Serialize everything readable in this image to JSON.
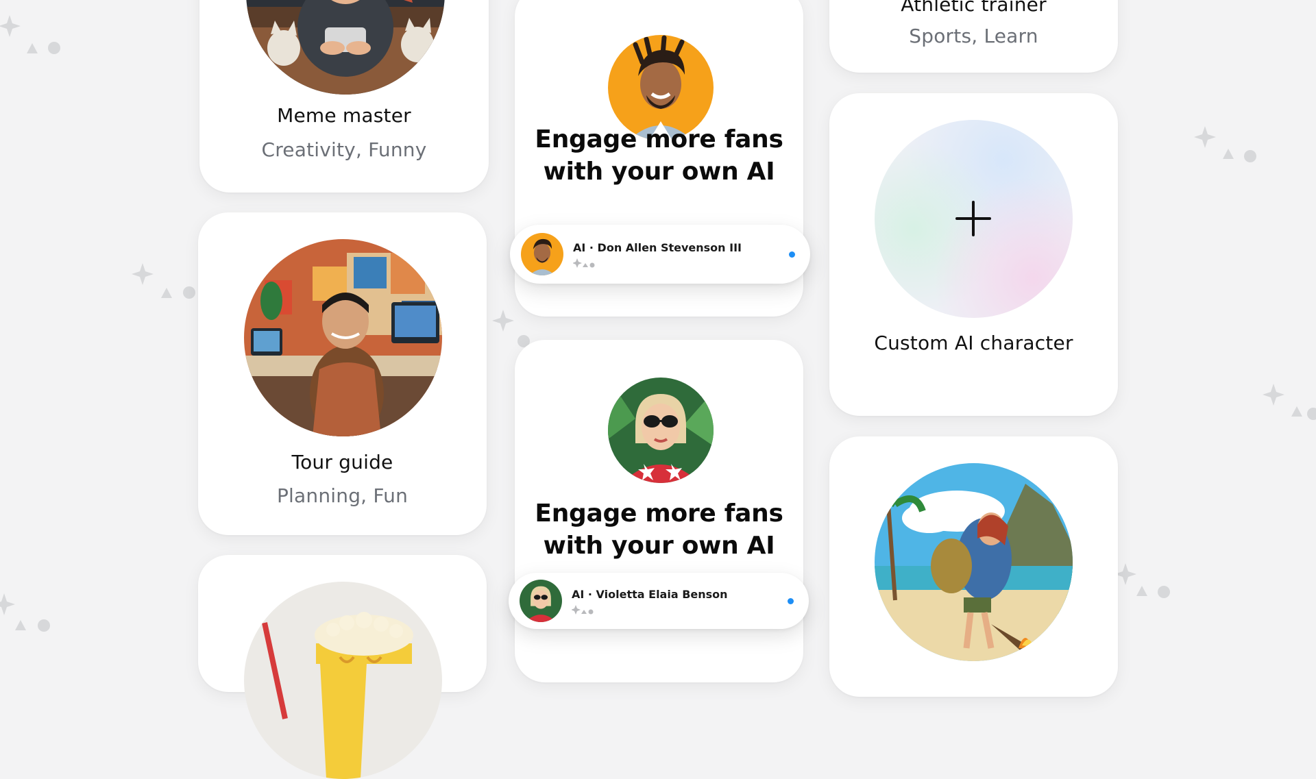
{
  "cards": {
    "meme_master": {
      "title": "Meme master",
      "subtitle": "Creativity, Funny"
    },
    "tour_guide": {
      "title": "Tour guide",
      "subtitle": "Planning, Fun"
    },
    "athletic_trainer": {
      "title": "Athletic trainer",
      "subtitle": "Sports, Learn"
    },
    "custom": {
      "title": "Custom AI character"
    }
  },
  "promos": [
    {
      "heading_line1": "Engage more fans",
      "heading_line2": "with your own AI",
      "pill_name": "AI · Don Allen Stevenson III"
    },
    {
      "heading_line1": "Engage more fans",
      "heading_line2": "with your own AI",
      "pill_name": "AI · Violetta Elaia Benson"
    }
  ],
  "colors": {
    "background": "#f3f3f4",
    "card": "#ffffff",
    "subtitle": "#6b6f76",
    "status_dot": "#1d8ef5"
  },
  "icons": [
    "sparkle-deco-icon",
    "plus-icon",
    "typing-indicator-icon",
    "online-dot-icon"
  ]
}
